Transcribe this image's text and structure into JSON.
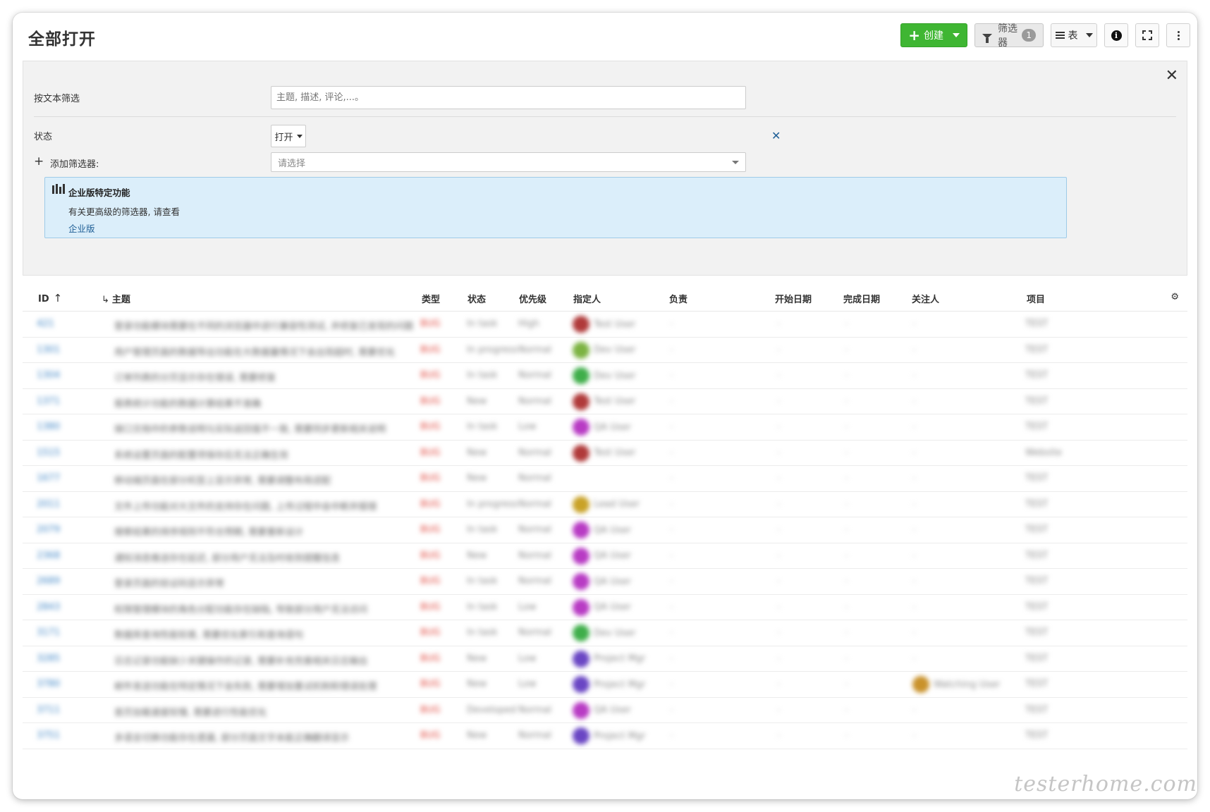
{
  "header": {
    "title": "全部打开",
    "create_label": "创建",
    "filter_label": "筛选器",
    "filter_count": "1",
    "view_label": "表"
  },
  "filter_panel": {
    "text_filter_label": "按文本筛选",
    "text_filter_placeholder": "主题, 描述, 评论,...。",
    "status_label": "状态",
    "status_value": "打开",
    "add_filter_label": "添加筛选器:",
    "add_filter_placeholder": "请选择",
    "enterprise": {
      "title": "企业版特定功能",
      "text": "有关更高级的筛选器, 请查看",
      "link": "企业版"
    }
  },
  "table": {
    "columns": {
      "id": "ID",
      "subject": "主题",
      "type": "类型",
      "status": "状态",
      "priority": "优先级",
      "assignee": "指定人",
      "responsible": "负责",
      "start_date": "开始日期",
      "finish_date": "完成日期",
      "watchers": "关注人",
      "project": "项目"
    },
    "rows": [
      {
        "id": "421",
        "subject": "登录功能模块需要在不同的浏览器中进行兼容性测试, 并修复已发现的问题",
        "type": "BUG",
        "status": "In task",
        "priority": "High",
        "assignee": "Test User",
        "avatar": "#b03a3a",
        "watcher": "",
        "watcher_avatar": "",
        "project": "TEST"
      },
      {
        "id": "1301",
        "subject": "用户管理页面的数据导出功能在大数据量情况下会出现超时, 需要优化",
        "type": "BUG",
        "status": "In progress",
        "priority": "Normal",
        "assignee": "Dev User",
        "avatar": "#7cb342",
        "watcher": "",
        "watcher_avatar": "",
        "project": "TEST"
      },
      {
        "id": "1304",
        "subject": "订单列表的分页显示存在错误, 需要修复",
        "type": "BUG",
        "status": "In task",
        "priority": "Normal",
        "assignee": "Dev User",
        "avatar": "#3fae4a",
        "watcher": "",
        "watcher_avatar": "",
        "project": "TEST"
      },
      {
        "id": "1371",
        "subject": "报表统计功能的数据计算结果不准确",
        "type": "BUG",
        "status": "New",
        "priority": "Normal",
        "assignee": "Test User",
        "avatar": "#b03a3a",
        "watcher": "",
        "watcher_avatar": "",
        "project": "TEST"
      },
      {
        "id": "1380",
        "subject": "接口文档中的参数说明与实际返回值不一致, 需要同步更新相关说明",
        "type": "BUG",
        "status": "In task",
        "priority": "Low",
        "assignee": "QA User",
        "avatar": "#b83bc4",
        "watcher": "",
        "watcher_avatar": "",
        "project": "TEST"
      },
      {
        "id": "1515",
        "subject": "系统设置页面的配置项保存后无法正确生效",
        "type": "BUG",
        "status": "New",
        "priority": "Normal",
        "assignee": "Test User",
        "avatar": "#b03a3a",
        "watcher": "",
        "watcher_avatar": "",
        "project": "Website"
      },
      {
        "id": "1677",
        "subject": "移动端页面在部分机型上显示异常, 需要调整布局适配",
        "type": "BUG",
        "status": "New",
        "priority": "Normal",
        "assignee": "",
        "avatar": "",
        "watcher": "",
        "watcher_avatar": "",
        "project": "TEST"
      },
      {
        "id": "2011",
        "subject": "文件上传功能对大文件的支持存在问题, 上传过程中会中断并报错",
        "type": "BUG",
        "status": "In progress",
        "priority": "Normal",
        "assignee": "Lead User",
        "avatar": "#c9a227",
        "watcher": "",
        "watcher_avatar": "",
        "project": "TEST"
      },
      {
        "id": "2079",
        "subject": "搜索结果的排序规则不符合预期, 需要重新设计",
        "type": "BUG",
        "status": "In task",
        "priority": "Normal",
        "assignee": "QA User",
        "avatar": "#b83bc4",
        "watcher": "",
        "watcher_avatar": "",
        "project": "TEST"
      },
      {
        "id": "2368",
        "subject": "通知消息推送存在延迟, 部分用户无法及时收到提醒信息",
        "type": "BUG",
        "status": "New",
        "priority": "Normal",
        "assignee": "QA User",
        "avatar": "#b83bc4",
        "watcher": "",
        "watcher_avatar": "",
        "project": "TEST"
      },
      {
        "id": "2689",
        "subject": "登录页面的验证码显示异常",
        "type": "BUG",
        "status": "In task",
        "priority": "Normal",
        "assignee": "QA User",
        "avatar": "#b83bc4",
        "watcher": "",
        "watcher_avatar": "",
        "project": "TEST"
      },
      {
        "id": "2843",
        "subject": "权限管理模块的角色分配功能存在缺陷, 导致部分用户无法访问",
        "type": "BUG",
        "status": "In task",
        "priority": "Low",
        "assignee": "QA User",
        "avatar": "#b83bc4",
        "watcher": "",
        "watcher_avatar": "",
        "project": "TEST"
      },
      {
        "id": "3171",
        "subject": "数据库查询性能较差, 需要优化索引和查询语句",
        "type": "BUG",
        "status": "In task",
        "priority": "Normal",
        "assignee": "Dev User",
        "avatar": "#3fae4a",
        "watcher": "",
        "watcher_avatar": "",
        "project": "TEST"
      },
      {
        "id": "3285",
        "subject": "日志记录功能缺少关键操作的记录, 需要补充完善相关日志输出",
        "type": "BUG",
        "status": "New",
        "priority": "Low",
        "assignee": "Project Mgr",
        "avatar": "#6a46c4",
        "watcher": "",
        "watcher_avatar": "",
        "project": "TEST"
      },
      {
        "id": "3780",
        "subject": "邮件发送功能在特定情况下会失败, 需要增加重试机制和错误处理",
        "type": "BUG",
        "status": "New",
        "priority": "Low",
        "assignee": "Project Mgr",
        "avatar": "#6a46c4",
        "watcher": "Watching User",
        "watcher_avatar": "#c9922b",
        "project": "TEST"
      },
      {
        "id": "3711",
        "subject": "首页加载速度较慢, 需要进行性能优化",
        "type": "BUG",
        "status": "Developed",
        "priority": "Normal",
        "assignee": "QA User",
        "avatar": "#b83bc4",
        "watcher": "",
        "watcher_avatar": "",
        "project": "TEST"
      },
      {
        "id": "3751",
        "subject": "多语言切换功能存在遗漏, 部分页面文字未能正确翻译显示",
        "type": "BUG",
        "status": "New",
        "priority": "Normal",
        "assignee": "Project Mgr",
        "avatar": "#6a46c4",
        "watcher": "",
        "watcher_avatar": "",
        "project": "TEST"
      }
    ]
  },
  "watermark": "testerhome.com"
}
